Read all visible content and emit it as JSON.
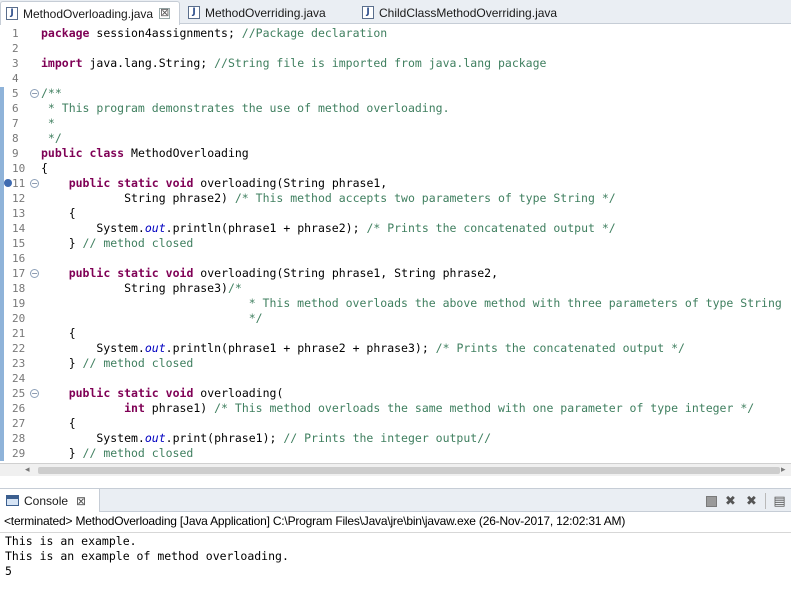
{
  "editor_tabs": [
    {
      "label": "MethodOverloading.java",
      "active": true,
      "close": "⊠"
    },
    {
      "label": "MethodOverriding.java",
      "active": false
    },
    {
      "label": "ChildClassMethodOverriding.java",
      "active": false
    }
  ],
  "code": [
    {
      "n": "1",
      "parts": [
        [
          "kw",
          "package"
        ],
        [
          "t",
          " session4assignments; "
        ],
        [
          "cm",
          "//Package declaration"
        ]
      ]
    },
    {
      "n": "2",
      "parts": []
    },
    {
      "n": "3",
      "parts": [
        [
          "kw",
          "import"
        ],
        [
          "t",
          " java.lang.String; "
        ],
        [
          "cm",
          "//String file is imported from java.lang package"
        ]
      ]
    },
    {
      "n": "4",
      "parts": []
    },
    {
      "n": "5",
      "fold": "⊖",
      "parts": [
        [
          "cm",
          "/**"
        ]
      ]
    },
    {
      "n": "6",
      "parts": [
        [
          "cm",
          " * This program demonstrates the use of method overloading."
        ]
      ]
    },
    {
      "n": "7",
      "parts": [
        [
          "cm",
          " *"
        ]
      ]
    },
    {
      "n": "8",
      "parts": [
        [
          "cm",
          " */"
        ]
      ]
    },
    {
      "n": "9",
      "parts": [
        [
          "kw",
          "public"
        ],
        [
          "t",
          " "
        ],
        [
          "kw",
          "class"
        ],
        [
          "t",
          " MethodOverloading"
        ]
      ]
    },
    {
      "n": "10",
      "parts": [
        [
          "t",
          "{"
        ]
      ]
    },
    {
      "n": "11",
      "fold": "⊖",
      "marker": true,
      "parts": [
        [
          "t",
          "    "
        ],
        [
          "kw",
          "public"
        ],
        [
          "t",
          " "
        ],
        [
          "kw",
          "static"
        ],
        [
          "t",
          " "
        ],
        [
          "kw",
          "void"
        ],
        [
          "t",
          " overloading(String phrase1,"
        ]
      ]
    },
    {
      "n": "12",
      "parts": [
        [
          "t",
          "            String phrase2) "
        ],
        [
          "cm",
          "/* This method accepts two parameters of type String */"
        ]
      ]
    },
    {
      "n": "13",
      "parts": [
        [
          "t",
          "    {"
        ]
      ]
    },
    {
      "n": "14",
      "parts": [
        [
          "t",
          "        System."
        ],
        [
          "fld",
          "out"
        ],
        [
          "t",
          ".println(phrase1 + phrase2); "
        ],
        [
          "cm",
          "/* Prints the concatenated output */"
        ]
      ]
    },
    {
      "n": "15",
      "parts": [
        [
          "t",
          "    } "
        ],
        [
          "cm",
          "// method closed"
        ]
      ]
    },
    {
      "n": "16",
      "parts": []
    },
    {
      "n": "17",
      "fold": "⊖",
      "parts": [
        [
          "t",
          "    "
        ],
        [
          "kw",
          "public"
        ],
        [
          "t",
          " "
        ],
        [
          "kw",
          "static"
        ],
        [
          "t",
          " "
        ],
        [
          "kw",
          "void"
        ],
        [
          "t",
          " overloading(String phrase1, String phrase2,"
        ]
      ]
    },
    {
      "n": "18",
      "parts": [
        [
          "t",
          "            String phrase3)"
        ],
        [
          "cm",
          "/*"
        ]
      ]
    },
    {
      "n": "19",
      "parts": [
        [
          "cm",
          "                              * This method overloads the above method with three parameters of type String"
        ]
      ]
    },
    {
      "n": "20",
      "parts": [
        [
          "cm",
          "                              */"
        ]
      ]
    },
    {
      "n": "21",
      "parts": [
        [
          "t",
          "    {"
        ]
      ]
    },
    {
      "n": "22",
      "parts": [
        [
          "t",
          "        System."
        ],
        [
          "fld",
          "out"
        ],
        [
          "t",
          ".println(phrase1 + phrase2 + phrase3); "
        ],
        [
          "cm",
          "/* Prints the concatenated output */"
        ]
      ]
    },
    {
      "n": "23",
      "parts": [
        [
          "t",
          "    } "
        ],
        [
          "cm",
          "// method closed"
        ]
      ]
    },
    {
      "n": "24",
      "parts": []
    },
    {
      "n": "25",
      "fold": "⊖",
      "parts": [
        [
          "t",
          "    "
        ],
        [
          "kw",
          "public"
        ],
        [
          "t",
          " "
        ],
        [
          "kw",
          "static"
        ],
        [
          "t",
          " "
        ],
        [
          "kw",
          "void"
        ],
        [
          "t",
          " overloading("
        ]
      ]
    },
    {
      "n": "26",
      "parts": [
        [
          "t",
          "            "
        ],
        [
          "kw",
          "int"
        ],
        [
          "t",
          " phrase1) "
        ],
        [
          "cm",
          "/* This method overloads the same method with one parameter of type integer */"
        ]
      ]
    },
    {
      "n": "27",
      "parts": [
        [
          "t",
          "    {"
        ]
      ]
    },
    {
      "n": "28",
      "parts": [
        [
          "t",
          "        System."
        ],
        [
          "fld",
          "out"
        ],
        [
          "t",
          ".print(phrase1); "
        ],
        [
          "cm",
          "// Prints the integer output//"
        ]
      ]
    },
    {
      "n": "29",
      "parts": [
        [
          "t",
          "    } "
        ],
        [
          "cm",
          "// method closed"
        ]
      ]
    }
  ],
  "console": {
    "tab_label": "Console",
    "tab_close": "⊠",
    "status": "<terminated> MethodOverloading [Java Application] C:\\Program Files\\Java\\jre\\bin\\javaw.exe (26-Nov-2017, 12:02:31 AM)",
    "output": [
      "This is an example.",
      "This is an example of method overloading.",
      "5"
    ],
    "tools": [
      "terminate-icon",
      "remove-launch-icon",
      "remove-all-launches-icon",
      "clear-console-icon"
    ]
  },
  "colors": {
    "keyword": "#7f0055",
    "comment": "#3f7f5f",
    "field": "#0000c0",
    "tab_bar": "#eaeef3"
  }
}
